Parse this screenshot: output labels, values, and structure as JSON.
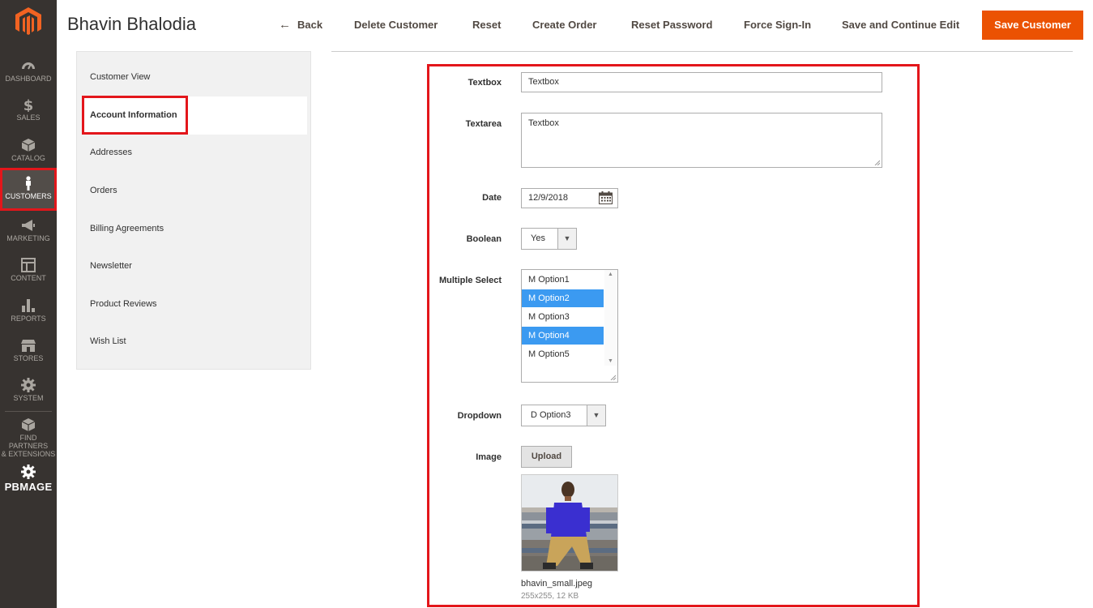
{
  "nav": {
    "items": [
      {
        "label": "DASHBOARD",
        "icon": "dashboard-icon"
      },
      {
        "label": "SALES",
        "icon": "dollar-icon"
      },
      {
        "label": "CATALOG",
        "icon": "box-icon"
      },
      {
        "label": "CUSTOMERS",
        "icon": "person-icon"
      },
      {
        "label": "MARKETING",
        "icon": "megaphone-icon"
      },
      {
        "label": "CONTENT",
        "icon": "layout-icon"
      },
      {
        "label": "REPORTS",
        "icon": "bar-chart-icon"
      },
      {
        "label": "STORES",
        "icon": "store-icon"
      },
      {
        "label": "SYSTEM",
        "icon": "gear-icon"
      }
    ],
    "partners_line1": "FIND PARTNERS",
    "partners_line2": "& EXTENSIONS",
    "pbmage": "PBMAGE",
    "accent": "#eb5202",
    "highlight": "#e3161b"
  },
  "header": {
    "title": "Bhavin Bhalodia",
    "back": "Back",
    "delete": "Delete Customer",
    "reset": "Reset",
    "create_order": "Create Order",
    "reset_password": "Reset Password",
    "force_signin": "Force Sign-In",
    "save_continue": "Save and Continue Edit",
    "save": "Save Customer"
  },
  "tabs": {
    "customer_view": "Customer View",
    "account_information": "Account Information",
    "addresses": "Addresses",
    "orders": "Orders",
    "billing_agreements": "Billing Agreements",
    "newsletter": "Newsletter",
    "product_reviews": "Product Reviews",
    "wish_list": "Wish List"
  },
  "form": {
    "textbox_label": "Textbox",
    "textbox_value": "Textbox",
    "textarea_label": "Textarea",
    "textarea_value": "Textbox",
    "date_label": "Date",
    "date_value": "12/9/2018",
    "boolean_label": "Boolean",
    "boolean_value": "Yes",
    "multi_label": "Multiple Select",
    "multi_options": [
      "M Option1",
      "M Option2",
      "M Option3",
      "M Option4",
      "M Option5"
    ],
    "multi_selected": [
      "M Option2",
      "M Option4"
    ],
    "dropdown_label": "Dropdown",
    "dropdown_value": "D Option3",
    "image_label": "Image",
    "upload": "Upload",
    "file_name": "bhavin_small.jpeg",
    "file_meta": "255x255, 12 KB"
  }
}
